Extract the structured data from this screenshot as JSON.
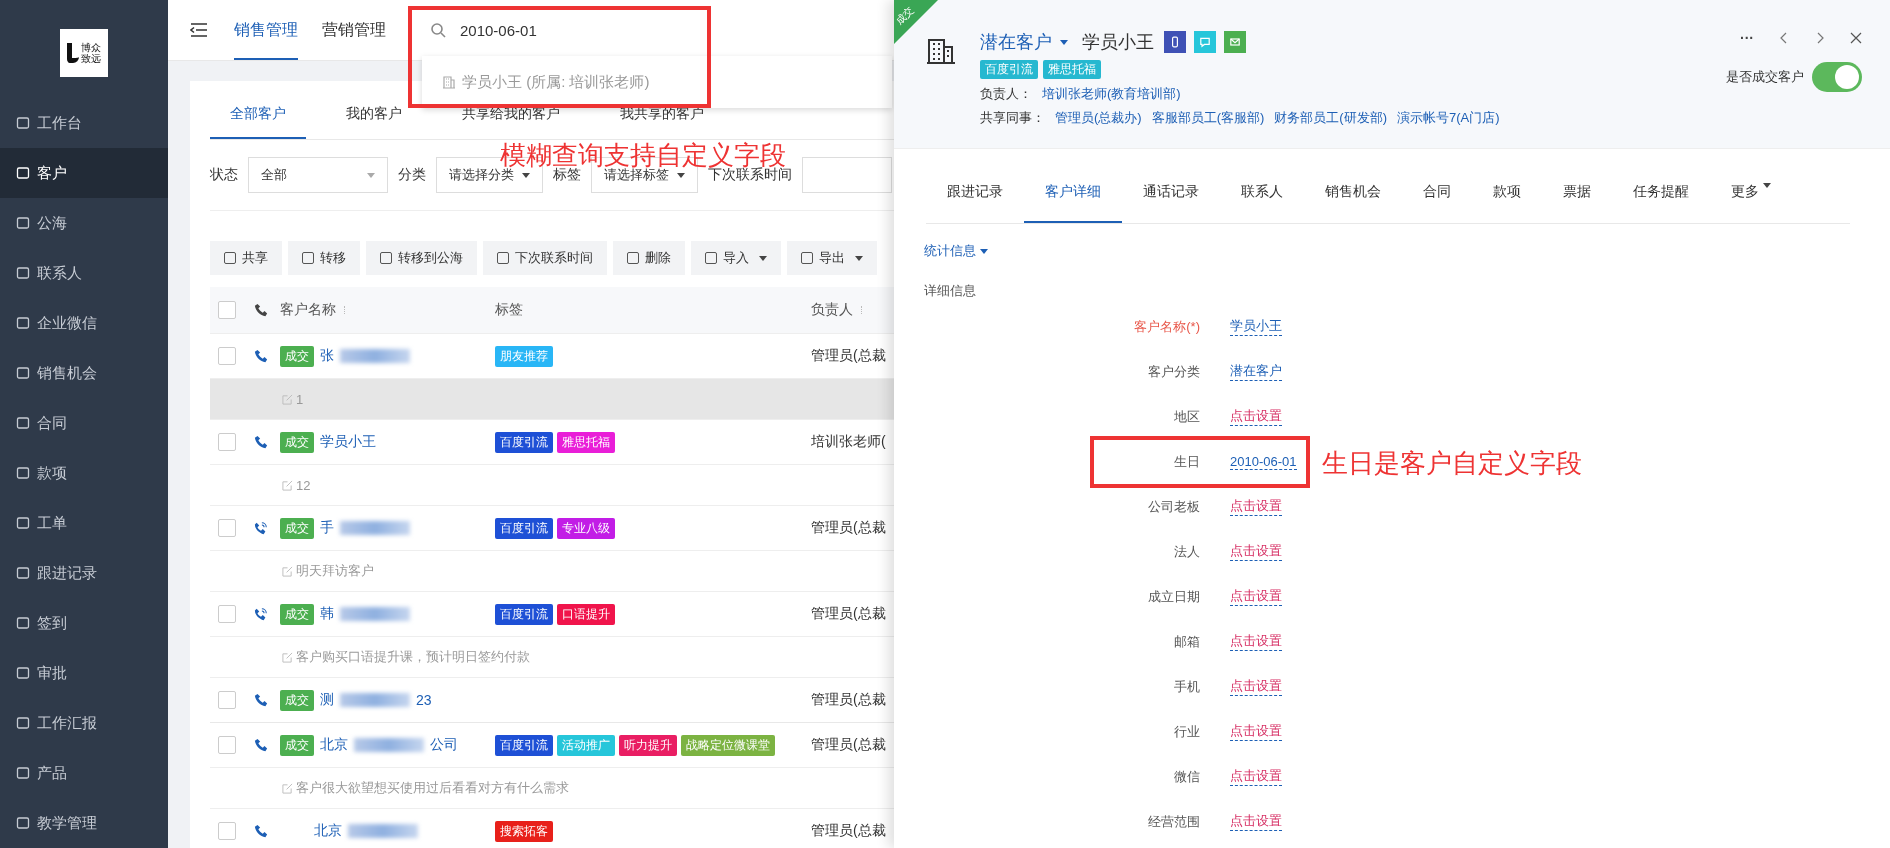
{
  "sidebar": {
    "logo_lines": [
      "博众",
      "致远"
    ],
    "items": [
      {
        "label": "工作台",
        "selected": false
      },
      {
        "label": "客户",
        "selected": true
      },
      {
        "label": "公海",
        "selected": false
      },
      {
        "label": "联系人",
        "selected": false
      },
      {
        "label": "企业微信",
        "selected": false
      },
      {
        "label": "销售机会",
        "selected": false
      },
      {
        "label": "合同",
        "selected": false
      },
      {
        "label": "款项",
        "selected": false
      },
      {
        "label": "工单",
        "selected": false
      },
      {
        "label": "跟进记录",
        "selected": false
      },
      {
        "label": "签到",
        "selected": false
      },
      {
        "label": "审批",
        "selected": false
      },
      {
        "label": "工作汇报",
        "selected": false
      },
      {
        "label": "产品",
        "selected": false
      },
      {
        "label": "教学管理",
        "selected": false
      }
    ]
  },
  "top_nav": {
    "tabs": [
      {
        "label": "销售管理",
        "selected": true
      },
      {
        "label": "营销管理",
        "selected": false
      }
    ],
    "search": {
      "value": "2010-06-01",
      "suggestions": [
        "学员小王 (所属: 培训张老师)"
      ]
    }
  },
  "annotations": [
    {
      "text": "模糊查询支持自定义字段"
    },
    {
      "text": "生日是客户自定义字段"
    }
  ],
  "list": {
    "tabs": [
      {
        "label": "全部客户",
        "selected": true
      },
      {
        "label": "我的客户",
        "selected": false
      },
      {
        "label": "共享给我的客户",
        "selected": false
      },
      {
        "label": "我共享的客户",
        "selected": false
      }
    ],
    "filters": [
      {
        "label": "状态",
        "value": "全部",
        "kind": "wide"
      },
      {
        "label": "分类",
        "value": "请选择分类",
        "kind": "compact"
      },
      {
        "label": "标签",
        "value": "请选择标签",
        "kind": "compact"
      },
      {
        "label": "下次联系时间",
        "kind": "input"
      }
    ],
    "actions": [
      {
        "label": "共享",
        "dropdown": false
      },
      {
        "label": "转移",
        "dropdown": false
      },
      {
        "label": "转移到公海",
        "dropdown": false
      },
      {
        "label": "下次联系时间",
        "dropdown": false
      },
      {
        "label": "删除",
        "dropdown": false
      },
      {
        "label": "导入",
        "dropdown": true
      },
      {
        "label": "导出",
        "dropdown": true
      }
    ],
    "select_all_checked": false,
    "columns": [
      "客户名称",
      "标签",
      "负责人"
    ],
    "rows": [
      {
        "checked": false,
        "status": "成交",
        "calling": false,
        "name": "张",
        "blurred": true,
        "tags": [
          {
            "text": "朋友推荐",
            "color": "#29b6f6"
          }
        ],
        "owner": "管理员(总裁",
        "note": {
          "text": "1",
          "highlighted": true
        }
      },
      {
        "checked": false,
        "status": "成交",
        "calling": false,
        "name": "学员小王",
        "blurred": false,
        "tags": [
          {
            "text": "百度引流",
            "color": "#1e50d6"
          },
          {
            "text": "雅思托福",
            "color": "#e91ed8"
          }
        ],
        "owner": "培训张老师(",
        "note": {
          "text": "12",
          "highlighted": false
        }
      },
      {
        "checked": false,
        "status": "成交",
        "calling": true,
        "name": "手",
        "blurred": true,
        "tags": [
          {
            "text": "百度引流",
            "color": "#1e50d6"
          },
          {
            "text": "专业八级",
            "color": "#c21de6"
          }
        ],
        "owner": "管理员(总裁",
        "note": {
          "text": "明天拜访客户",
          "highlighted": false
        }
      },
      {
        "checked": false,
        "status": "成交",
        "calling": true,
        "name": "韩",
        "blurred": true,
        "tags": [
          {
            "text": "百度引流",
            "color": "#1e50d6"
          },
          {
            "text": "口语提升",
            "color": "#f0144b"
          }
        ],
        "owner": "管理员(总裁",
        "note": {
          "text": "客户购买口语提升课，预计明日签约付款",
          "highlighted": false
        }
      },
      {
        "checked": false,
        "status": "成交",
        "calling": false,
        "name": "测",
        "blurred": true,
        "name_end": "23",
        "tags": [],
        "owner": "管理员(总裁"
      },
      {
        "checked": false,
        "status": "成交",
        "calling": false,
        "name": "北京",
        "blurred": true,
        "name_end": "公司",
        "tags": [
          {
            "text": "百度引流",
            "color": "#1e50d6"
          },
          {
            "text": "活动推广",
            "color": "#26c6da"
          },
          {
            "text": "听力提升",
            "color": "#e91e63"
          },
          {
            "text": "战略定位微课堂",
            "color": "#7cb342"
          }
        ],
        "owner": "管理员(总裁",
        "note": {
          "text": "客户很大欲望想买使用过后看看对方有什么需求",
          "highlighted": false
        }
      },
      {
        "checked": false,
        "calling": false,
        "name": "北京",
        "blurred": true,
        "tags": [
          {
            "text": "搜索拓客",
            "color": "#e8201a"
          }
        ],
        "owner": "管理员(总裁"
      }
    ]
  },
  "drawer": {
    "ribbon": "成交",
    "category": "潜在客户",
    "name": "学员小王",
    "tags": [
      "百度引流",
      "雅思托福"
    ],
    "owner_label": "负责人：",
    "owner": "培训张老师(教育培训部)",
    "shared_label": "共享同事：",
    "shared": [
      "管理员(总裁办)",
      "客服部员工(客服部)",
      "财务部员工(研发部)",
      "演示帐号7(A门店)"
    ],
    "more": "···",
    "deal_toggle": {
      "label": "是否成交客户",
      "on": true
    },
    "tabs": [
      {
        "label": "跟进记录",
        "selected": false
      },
      {
        "label": "客户详细",
        "selected": true
      },
      {
        "label": "通话记录",
        "selected": false
      },
      {
        "label": "联系人",
        "selected": false
      },
      {
        "label": "销售机会",
        "selected": false
      },
      {
        "label": "合同",
        "selected": false
      },
      {
        "label": "款项",
        "selected": false
      },
      {
        "label": "票据",
        "selected": false
      },
      {
        "label": "任务提醒",
        "selected": false
      },
      {
        "label": "更多",
        "selected": false
      }
    ],
    "stats_link": "统计信息",
    "section_title": "详细信息",
    "fields": [
      {
        "label": "客户名称(*)",
        "required": true,
        "kind": "value",
        "value": "学员小王",
        "annotated": false
      },
      {
        "label": "客户分类",
        "required": false,
        "kind": "value",
        "value": "潜在客户",
        "annotated": false
      },
      {
        "label": "地区",
        "required": false,
        "kind": "empty",
        "value": "点击设置",
        "annotated": false
      },
      {
        "label": "生日",
        "required": false,
        "kind": "value",
        "value": "2010-06-01",
        "annotated": true
      },
      {
        "label": "公司老板",
        "required": false,
        "kind": "empty",
        "value": "点击设置",
        "annotated": false
      },
      {
        "label": "法人",
        "required": false,
        "kind": "empty",
        "value": "点击设置",
        "annotated": false
      },
      {
        "label": "成立日期",
        "required": false,
        "kind": "empty",
        "value": "点击设置",
        "annotated": false
      },
      {
        "label": "邮箱",
        "required": false,
        "kind": "empty",
        "value": "点击设置",
        "annotated": false
      },
      {
        "label": "手机",
        "required": false,
        "kind": "empty",
        "value": "点击设置",
        "annotated": false
      },
      {
        "label": "行业",
        "required": false,
        "kind": "empty",
        "value": "点击设置",
        "annotated": false
      },
      {
        "label": "微信",
        "required": false,
        "kind": "empty",
        "value": "点击设置",
        "annotated": false
      },
      {
        "label": "经营范围",
        "required": false,
        "kind": "empty",
        "value": "点击设置",
        "annotated": false
      }
    ]
  }
}
